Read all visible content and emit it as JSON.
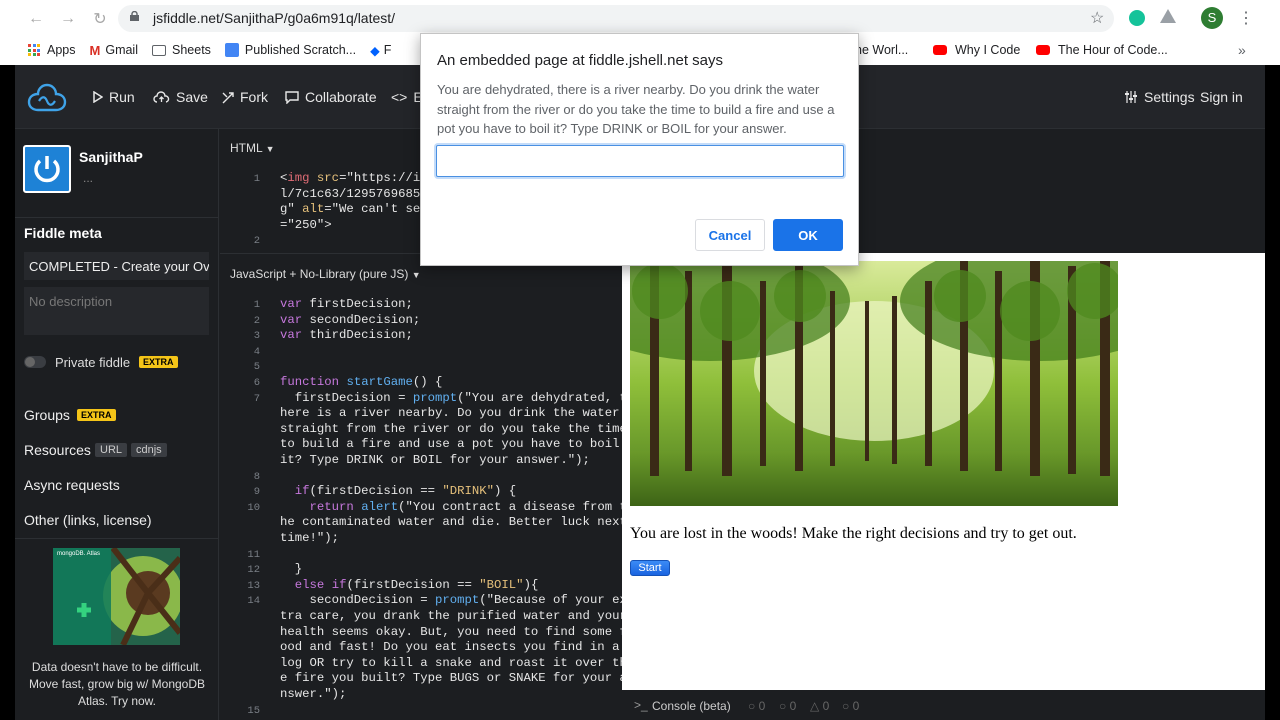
{
  "browser": {
    "url": "jsfiddle.net/SanjithaP/g0a6m91q/latest/",
    "profile_initial": "S",
    "bookmarks": [
      {
        "label": "Apps",
        "color": "#e8453c"
      },
      {
        "label": "Gmail",
        "color": "#d93025"
      },
      {
        "label": "Sheets",
        "color": "#5f6368"
      },
      {
        "label": "Published Scratch...",
        "color": "#4285f4"
      },
      {
        "label": "F",
        "color": "#0061fe"
      }
    ],
    "bookmarks_right": [
      {
        "label": "he Worl...",
        "color": ""
      },
      {
        "label": "Why I Code",
        "color": "#ff0000"
      },
      {
        "label": "The Hour of Code...",
        "color": "#ff0000"
      }
    ],
    "overflow": "»"
  },
  "toolbar": {
    "run": "Run",
    "save": "Save",
    "fork": "Fork",
    "collaborate": "Collaborate",
    "embed": "E",
    "settings": "Settings",
    "signin": "Sign in"
  },
  "sidebar": {
    "username": "SanjithaP",
    "user_sub": "...",
    "meta_heading": "Fiddle meta",
    "title_value": "COMPLETED - Create your Ov",
    "description_placeholder": "No description",
    "private_label": "Private fiddle",
    "extra": "EXTRA",
    "groups": "Groups",
    "resources": "Resources",
    "url_tag": "URL",
    "cdnjs_tag": "cdnjs",
    "async": "Async requests",
    "other": "Other (links, license)",
    "ad_brand": "mongoDB. Atlas",
    "ad_text": "Data doesn't have to be difficult. Move fast, grow big w/ MongoDB Atlas. Try now."
  },
  "html_pane": {
    "header": "HTML",
    "lines": [
      {
        "n": "1",
        "text": "<img src=\"https://i.",
        "y": 0
      },
      {
        "n": "",
        "text": "l/7c1c63/1295769685/",
        "y": 1
      },
      {
        "n": "",
        "text": "g\" alt=\"We can't see",
        "y": 2
      },
      {
        "n": "",
        "text": "=\"250\">",
        "y": 3
      },
      {
        "n": "2",
        "text": "",
        "y": 4
      }
    ]
  },
  "js_pane": {
    "header": "JavaScript + No-Library (pure JS)",
    "lines": [
      {
        "n": "1",
        "text": "var firstDecision;"
      },
      {
        "n": "2",
        "text": "var secondDecision;"
      },
      {
        "n": "3",
        "text": "var thirdDecision;"
      },
      {
        "n": "4",
        "text": ""
      },
      {
        "n": "5",
        "text": ""
      },
      {
        "n": "6",
        "text": "function startGame() {"
      },
      {
        "n": "7",
        "text": "  firstDecision = prompt(\"You are dehydrated, t"
      },
      {
        "n": "",
        "text": "here is a river nearby. Do you drink the water"
      },
      {
        "n": "",
        "text": "straight from the river or do you take the time"
      },
      {
        "n": "",
        "text": "to build a fire and use a pot you have to boil"
      },
      {
        "n": "",
        "text": "it? Type DRINK or BOIL for your answer.\");"
      },
      {
        "n": "8",
        "text": ""
      },
      {
        "n": "9",
        "text": "  if(firstDecision == \"DRINK\") {"
      },
      {
        "n": "10",
        "text": "    return alert(\"You contract a disease from t"
      },
      {
        "n": "",
        "text": "he contaminated water and die. Better luck next"
      },
      {
        "n": "",
        "text": "time!\");"
      },
      {
        "n": "11",
        "text": ""
      },
      {
        "n": "12",
        "text": "  }"
      },
      {
        "n": "13",
        "text": "  else if(firstDecision == \"BOIL\"){"
      },
      {
        "n": "14",
        "text": "    secondDecision = prompt(\"Because of your ex"
      },
      {
        "n": "",
        "text": "tra care, you drank the purified water and your"
      },
      {
        "n": "",
        "text": "health seems okay. But, you need to find some f"
      },
      {
        "n": "",
        "text": "ood and fast! Do you eat insects you find in a"
      },
      {
        "n": "",
        "text": "log OR try to kill a snake and roast it over th"
      },
      {
        "n": "",
        "text": "e fire you built? Type BUGS or SNAKE for your a"
      },
      {
        "n": "",
        "text": "nswer.\");"
      },
      {
        "n": "15",
        "text": ""
      }
    ]
  },
  "result": {
    "message": "You are lost in the woods! Make the right decisions and try to get out.",
    "start_label": "Start"
  },
  "console": {
    "label": "Console (beta)",
    "counts": [
      "0",
      "0",
      "0",
      "0"
    ]
  },
  "dialog": {
    "title": "An embedded page at fiddle.jshell.net says",
    "message": "You are dehydrated, there is a river nearby. Do you drink the water straight from the river or do you take the time to build a fire and use a pot you have to boil it? Type DRINK or BOIL for your answer.",
    "input_value": "",
    "cancel": "Cancel",
    "ok": "OK"
  }
}
